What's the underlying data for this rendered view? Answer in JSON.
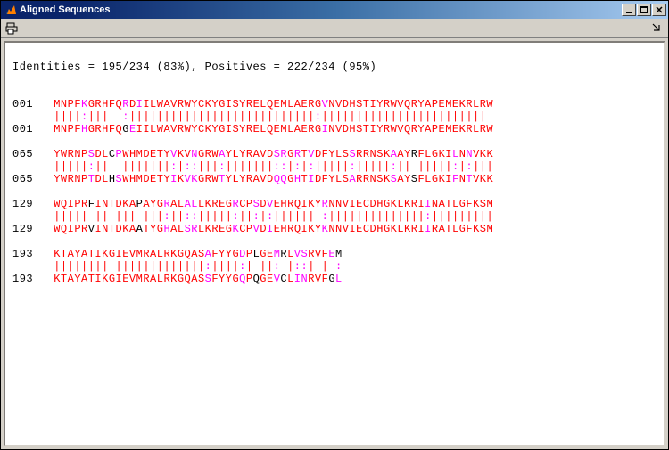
{
  "window": {
    "title": "Aligned Sequences",
    "controls": {
      "min": "_",
      "max": "☐",
      "close": "✕"
    }
  },
  "toolbar": {
    "print_tooltip": "Print",
    "dock_tooltip": "Dock"
  },
  "summary": "Identities = 195/234 (83%), Positives = 222/234 (95%)",
  "alignment": {
    "blocks": [
      {
        "label": "001",
        "top": [
          [
            "MNPF",
            "r"
          ],
          [
            "K",
            "m"
          ],
          [
            "GRHFQ",
            "r"
          ],
          [
            "R",
            "m"
          ],
          [
            "D",
            "r"
          ],
          [
            "I",
            "m"
          ],
          [
            "ILWAVRWYCKYGISYRELQEMLAERG",
            "r"
          ],
          [
            "V",
            "m"
          ],
          [
            "NVDHSTIYRWVQRYAPEMEKRLRW",
            "r"
          ]
        ],
        "match": [
          [
            "||||",
            "r"
          ],
          [
            ":",
            "m"
          ],
          [
            "||||",
            "r"
          ],
          [
            " ",
            "b"
          ],
          [
            ":",
            "m"
          ],
          [
            "|||||||||||||||||||||||||||",
            "r"
          ],
          [
            ":",
            "m"
          ],
          [
            "||||||||||||||||||||||||",
            "r"
          ]
        ],
        "bot": [
          [
            "MNPF",
            "r"
          ],
          [
            "H",
            "m"
          ],
          [
            "GRHFQ",
            "r"
          ],
          [
            "G",
            "b"
          ],
          [
            "E",
            "m"
          ],
          [
            "I",
            "r"
          ],
          [
            "ILWAVRWYCKYGISYRELQEMLAERG",
            "r"
          ],
          [
            "I",
            "m"
          ],
          [
            "NVDHSTIYRWVQRYAPEMEKRLRW",
            "r"
          ]
        ]
      },
      {
        "label": "065",
        "top": [
          [
            "YWRNP",
            "r"
          ],
          [
            "S",
            "m"
          ],
          [
            "DL",
            "r"
          ],
          [
            "C",
            "b"
          ],
          [
            "P",
            "m"
          ],
          [
            "WHMDETY",
            "r"
          ],
          [
            "V",
            "m"
          ],
          [
            "KV",
            "r"
          ],
          [
            "N",
            "m"
          ],
          [
            "GRW",
            "r"
          ],
          [
            "A",
            "m"
          ],
          [
            "YLYRAVD",
            "r"
          ],
          [
            "S",
            "m"
          ],
          [
            "R",
            "m"
          ],
          [
            "G",
            "r"
          ],
          [
            "R",
            "m"
          ],
          [
            "T",
            "r"
          ],
          [
            "V",
            "m"
          ],
          [
            "DFYLS",
            "r"
          ],
          [
            "S",
            "m"
          ],
          [
            "RRNSK",
            "r"
          ],
          [
            "A",
            "m"
          ],
          [
            "AY",
            "r"
          ],
          [
            "R",
            "b"
          ],
          [
            "FLGKI",
            "r"
          ],
          [
            "L",
            "m"
          ],
          [
            "N",
            "r"
          ],
          [
            "N",
            "m"
          ],
          [
            "VKK",
            "r"
          ]
        ],
        "match": [
          [
            "|||||",
            "r"
          ],
          [
            ":",
            "m"
          ],
          [
            "||",
            "r"
          ],
          [
            "  ",
            "b"
          ],
          [
            "|||||||",
            "r"
          ],
          [
            ":",
            "m"
          ],
          [
            "|",
            "r"
          ],
          [
            ":",
            "m"
          ],
          [
            ":",
            "m"
          ],
          [
            "|||",
            "r"
          ],
          [
            ":",
            "m"
          ],
          [
            "|||||||",
            "r"
          ],
          [
            ":",
            "m"
          ],
          [
            ":",
            "m"
          ],
          [
            "|",
            "r"
          ],
          [
            ":",
            "m"
          ],
          [
            "|",
            "r"
          ],
          [
            ":",
            "m"
          ],
          [
            "|||||",
            "r"
          ],
          [
            ":",
            "m"
          ],
          [
            "|||||",
            "r"
          ],
          [
            ":",
            "m"
          ],
          [
            "||",
            "r"
          ],
          [
            " ",
            "b"
          ],
          [
            "|||||",
            "r"
          ],
          [
            ":",
            "m"
          ],
          [
            "|",
            "r"
          ],
          [
            ":",
            "m"
          ],
          [
            "|||",
            "r"
          ]
        ],
        "bot": [
          [
            "YWRNP",
            "r"
          ],
          [
            "T",
            "m"
          ],
          [
            "DL",
            "r"
          ],
          [
            "H",
            "b"
          ],
          [
            "S",
            "m"
          ],
          [
            "WHMDETY",
            "r"
          ],
          [
            "I",
            "m"
          ],
          [
            "K",
            "r"
          ],
          [
            "V",
            "m"
          ],
          [
            "K",
            "m"
          ],
          [
            "GRW",
            "r"
          ],
          [
            "T",
            "m"
          ],
          [
            "YLYRAVD",
            "r"
          ],
          [
            "Q",
            "m"
          ],
          [
            "Q",
            "m"
          ],
          [
            "G",
            "r"
          ],
          [
            "H",
            "m"
          ],
          [
            "T",
            "r"
          ],
          [
            "I",
            "m"
          ],
          [
            "DFYLS",
            "r"
          ],
          [
            "A",
            "m"
          ],
          [
            "RRNSK",
            "r"
          ],
          [
            "S",
            "m"
          ],
          [
            "AY",
            "r"
          ],
          [
            "S",
            "b"
          ],
          [
            "FLGKI",
            "r"
          ],
          [
            "F",
            "m"
          ],
          [
            "N",
            "r"
          ],
          [
            "T",
            "m"
          ],
          [
            "VKK",
            "r"
          ]
        ]
      },
      {
        "label": "129",
        "top": [
          [
            "WQIPR",
            "r"
          ],
          [
            "F",
            "b"
          ],
          [
            "INTDKA",
            "r"
          ],
          [
            "P",
            "b"
          ],
          [
            "AYG",
            "r"
          ],
          [
            "R",
            "m"
          ],
          [
            "AL",
            "r"
          ],
          [
            "A",
            "m"
          ],
          [
            "L",
            "m"
          ],
          [
            "LKREG",
            "r"
          ],
          [
            "R",
            "m"
          ],
          [
            "CP",
            "r"
          ],
          [
            "S",
            "m"
          ],
          [
            "D",
            "r"
          ],
          [
            "V",
            "m"
          ],
          [
            "EHRQIKY",
            "r"
          ],
          [
            "R",
            "m"
          ],
          [
            "NNVIECDHGKLKRI",
            "r"
          ],
          [
            "I",
            "m"
          ],
          [
            "N",
            "r"
          ],
          [
            "ATLGFKSM",
            "r"
          ]
        ],
        "match": [
          [
            "|||||",
            "r"
          ],
          [
            " ",
            "b"
          ],
          [
            "||||||",
            "r"
          ],
          [
            " ",
            "b"
          ],
          [
            "|||",
            "r"
          ],
          [
            ":",
            "m"
          ],
          [
            "||",
            "r"
          ],
          [
            ":",
            "m"
          ],
          [
            ":",
            "m"
          ],
          [
            "|||||",
            "r"
          ],
          [
            ":",
            "m"
          ],
          [
            "||",
            "r"
          ],
          [
            ":",
            "m"
          ],
          [
            "|",
            "r"
          ],
          [
            ":",
            "m"
          ],
          [
            "|||||||",
            "r"
          ],
          [
            ":",
            "m"
          ],
          [
            "||||||||||||||",
            "r"
          ],
          [
            ":",
            "m"
          ],
          [
            "|",
            "r"
          ],
          [
            "||||||||",
            "r"
          ]
        ],
        "bot": [
          [
            "WQIPR",
            "r"
          ],
          [
            "V",
            "b"
          ],
          [
            "INTDKA",
            "r"
          ],
          [
            "A",
            "b"
          ],
          [
            "TYG",
            "r"
          ],
          [
            "H",
            "m"
          ],
          [
            "AL",
            "r"
          ],
          [
            "S",
            "m"
          ],
          [
            "R",
            "m"
          ],
          [
            "LKREG",
            "r"
          ],
          [
            "K",
            "m"
          ],
          [
            "CP",
            "r"
          ],
          [
            "V",
            "m"
          ],
          [
            "D",
            "r"
          ],
          [
            "I",
            "m"
          ],
          [
            "EHRQIKY",
            "r"
          ],
          [
            "K",
            "m"
          ],
          [
            "NNVIECDHGKLKRI",
            "r"
          ],
          [
            "I",
            "m"
          ],
          [
            "R",
            "r"
          ],
          [
            "ATLGFKSM",
            "r"
          ]
        ]
      },
      {
        "label": "193",
        "top": [
          [
            "KTAYATIKGIEVMRALRKGQAS",
            "r"
          ],
          [
            "A",
            "m"
          ],
          [
            "FYYG",
            "r"
          ],
          [
            "D",
            "m"
          ],
          [
            "P",
            "r"
          ],
          [
            "L",
            "b"
          ],
          [
            "GE",
            "r"
          ],
          [
            "M",
            "m"
          ],
          [
            "R",
            "b"
          ],
          [
            "L",
            "r"
          ],
          [
            "V",
            "m"
          ],
          [
            "S",
            "m"
          ],
          [
            "RVF",
            "r"
          ],
          [
            "E",
            "m"
          ],
          [
            "M",
            "b"
          ]
        ],
        "match": [
          [
            "||||||||||||||||||||||",
            "r"
          ],
          [
            ":",
            "m"
          ],
          [
            "||||",
            "r"
          ],
          [
            ":",
            "m"
          ],
          [
            "|",
            "r"
          ],
          [
            " ",
            "b"
          ],
          [
            "||",
            "r"
          ],
          [
            ":",
            "m"
          ],
          [
            " ",
            "b"
          ],
          [
            "|",
            "r"
          ],
          [
            ":",
            "m"
          ],
          [
            ":",
            "m"
          ],
          [
            "|||",
            "r"
          ],
          [
            " ",
            "b"
          ],
          [
            ":",
            "m"
          ]
        ],
        "bot": [
          [
            "KTAYATIKGIEVMRALRKGQAS",
            "r"
          ],
          [
            "S",
            "m"
          ],
          [
            "FYYG",
            "r"
          ],
          [
            "Q",
            "m"
          ],
          [
            "P",
            "r"
          ],
          [
            "Q",
            "b"
          ],
          [
            "GE",
            "r"
          ],
          [
            "V",
            "m"
          ],
          [
            "C",
            "b"
          ],
          [
            "L",
            "r"
          ],
          [
            "I",
            "m"
          ],
          [
            "N",
            "m"
          ],
          [
            "RVF",
            "r"
          ],
          [
            "G",
            "b"
          ],
          [
            "L",
            "m"
          ]
        ]
      }
    ]
  }
}
